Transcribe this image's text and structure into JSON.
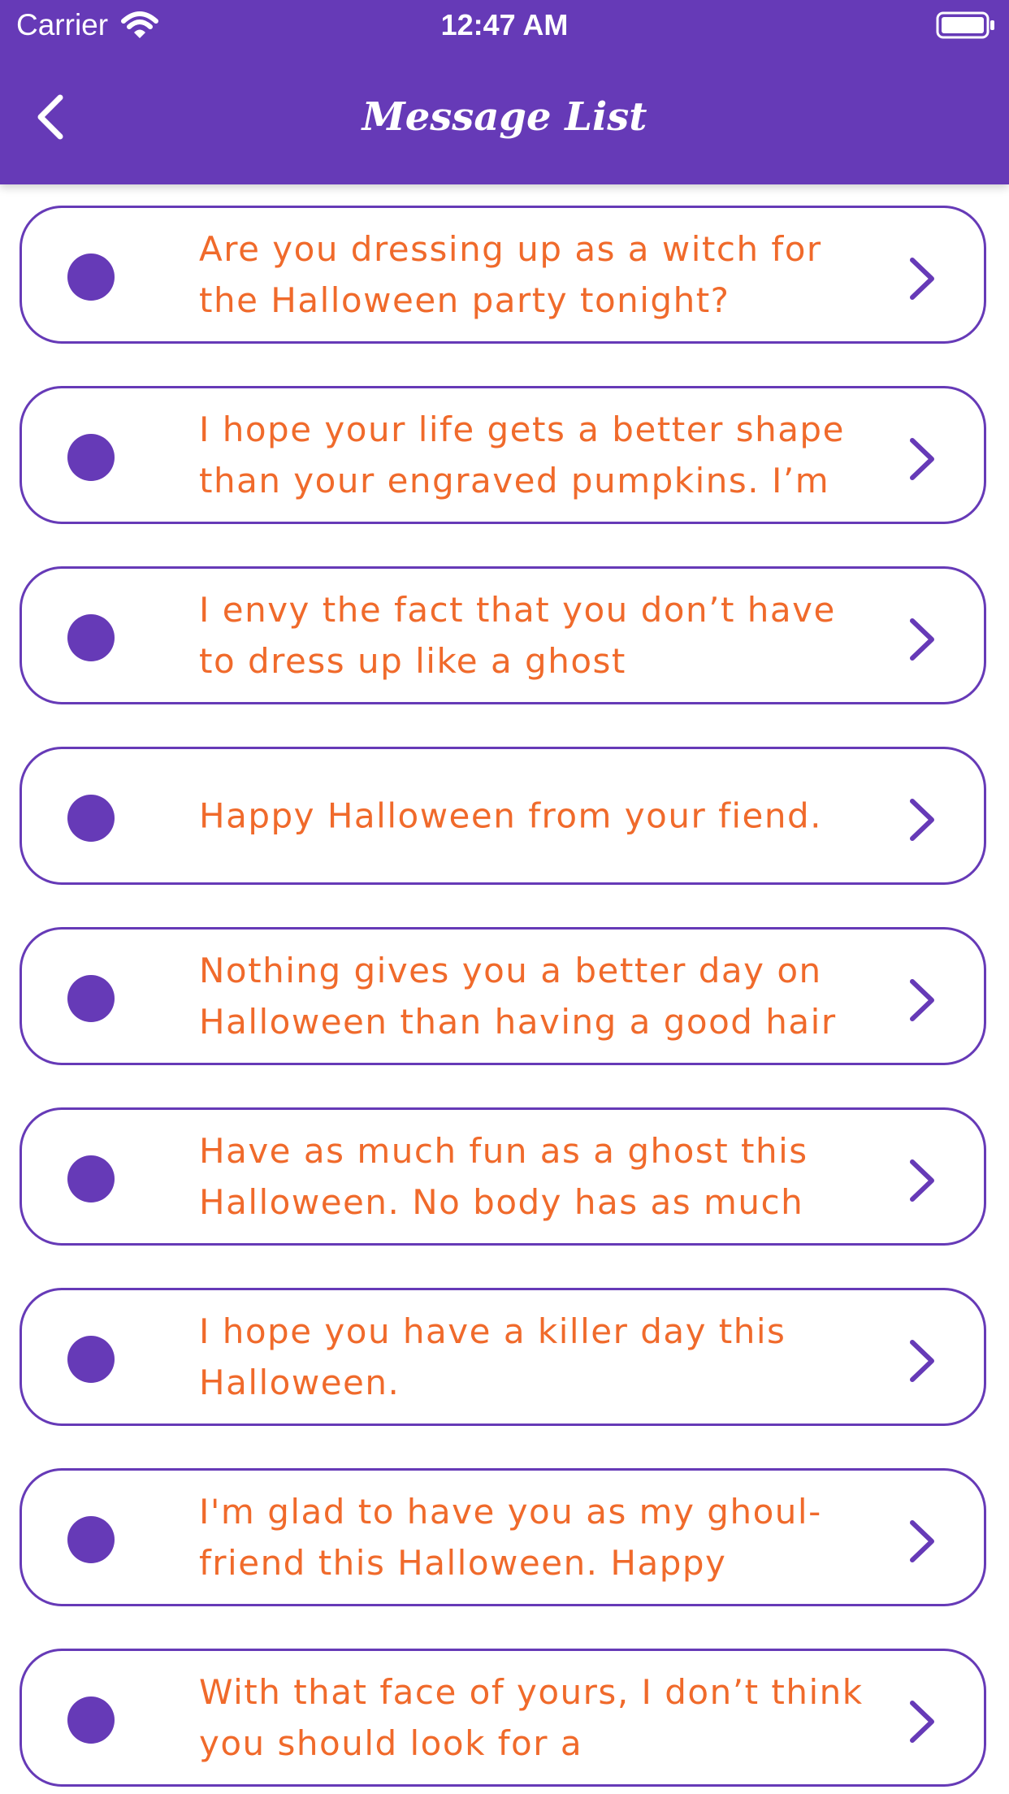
{
  "status_bar": {
    "carrier": "Carrier",
    "time": "12:47 AM"
  },
  "header": {
    "title": "Message List",
    "back_icon": "chevron-left-icon",
    "background_color": "#663ab7"
  },
  "colors": {
    "accent": "#663ab7",
    "message_text": "#f06a2b"
  },
  "messages": [
    {
      "text": "Are you dressing up as a witch for the Halloween party tonight?"
    },
    {
      "text": "I hope your life gets a better shape than your engraved pumpkins. I’m"
    },
    {
      "text": "I envy the fact that you don’t have to dress up like a ghost"
    },
    {
      "text": "Happy Halloween from your fiend."
    },
    {
      "text": "Nothing gives you a better day on Halloween than having a good hair"
    },
    {
      "text": "Have as much fun as a ghost this Halloween. No body has as much"
    },
    {
      "text": "I hope you have a killer day this Halloween."
    },
    {
      "text": "I'm glad to have you as my ghoul-friend this Halloween. Happy"
    },
    {
      "text": "With that face of yours, I don’t think you should look for a"
    }
  ]
}
